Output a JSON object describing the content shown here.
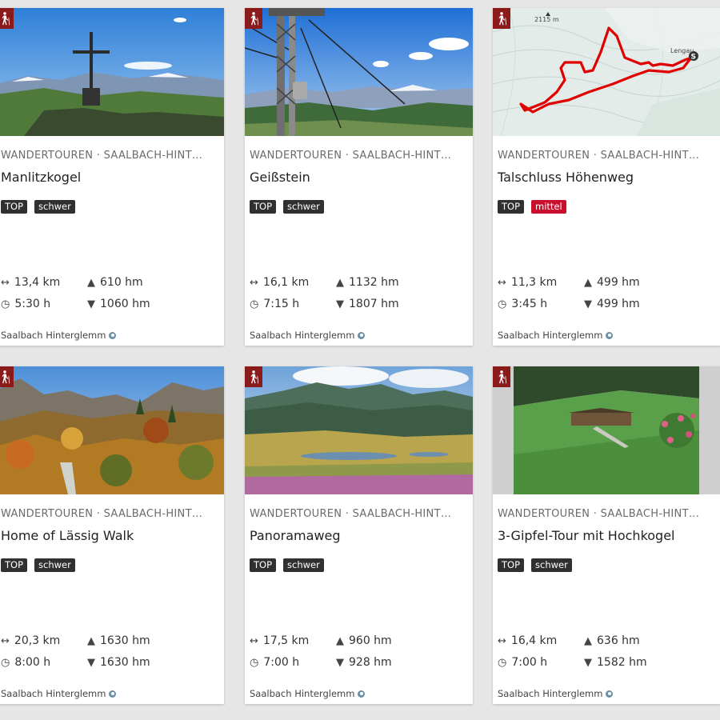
{
  "colors": {
    "hike_badge": "#8b1a1a",
    "tag_dark": "#303030",
    "tag_mittel": "#c8102e",
    "background": "#e6e6e6"
  },
  "icons": {
    "hike": "hiker-icon",
    "distance": "distance-arrow-icon",
    "duration": "clock-icon",
    "ascent": "triangle-up-icon",
    "descent": "triangle-down-icon",
    "verified": "verified-icon"
  },
  "tours": [
    {
      "category": "WANDERTOUREN · SAALBACH-HINT…",
      "title": "Manlitzkogel",
      "tags": [
        "TOP",
        "schwer"
      ],
      "distance": "13,4 km",
      "duration": "5:30 h",
      "ascent": "610 hm",
      "descent": "1060 hm",
      "region": "Saalbach Hinterglemm"
    },
    {
      "category": "WANDERTOUREN · SAALBACH-HINT…",
      "title": "Geißstein",
      "tags": [
        "TOP",
        "schwer"
      ],
      "distance": "16,1 km",
      "duration": "7:15 h",
      "ascent": "1132 hm",
      "descent": "1807 hm",
      "region": "Saalbach Hinterglemm"
    },
    {
      "category": "WANDERTOUREN · SAALBACH-HINT…",
      "title": "Talschluss Höhenweg",
      "tags": [
        "TOP",
        "mittel"
      ],
      "distance": "11,3 km",
      "duration": "3:45 h",
      "ascent": "499 hm",
      "descent": "499 hm",
      "region": "Saalbach Hinterglemm",
      "map_labels": {
        "summit": "2115 m",
        "place": "Lengau"
      }
    },
    {
      "category": "WANDERTOUREN · SAALBACH-HINT…",
      "title": "Home of Lässig Walk",
      "tags": [
        "TOP",
        "schwer"
      ],
      "distance": "20,3 km",
      "duration": "8:00 h",
      "ascent": "1630 hm",
      "descent": "1630 hm",
      "region": "Saalbach Hinterglemm"
    },
    {
      "category": "WANDERTOUREN · SAALBACH-HINT…",
      "title": "Panoramaweg",
      "tags": [
        "TOP",
        "schwer"
      ],
      "distance": "17,5 km",
      "duration": "7:00 h",
      "ascent": "960 hm",
      "descent": "928 hm",
      "region": "Saalbach Hinterglemm"
    },
    {
      "category": "WANDERTOUREN · SAALBACH-HINT…",
      "title": "3-Gipfel-Tour mit Hochkogel",
      "tags": [
        "TOP",
        "schwer"
      ],
      "distance": "16,4 km",
      "duration": "7:00 h",
      "ascent": "636 hm",
      "descent": "1582 hm",
      "region": "Saalbach Hinterglemm"
    }
  ]
}
